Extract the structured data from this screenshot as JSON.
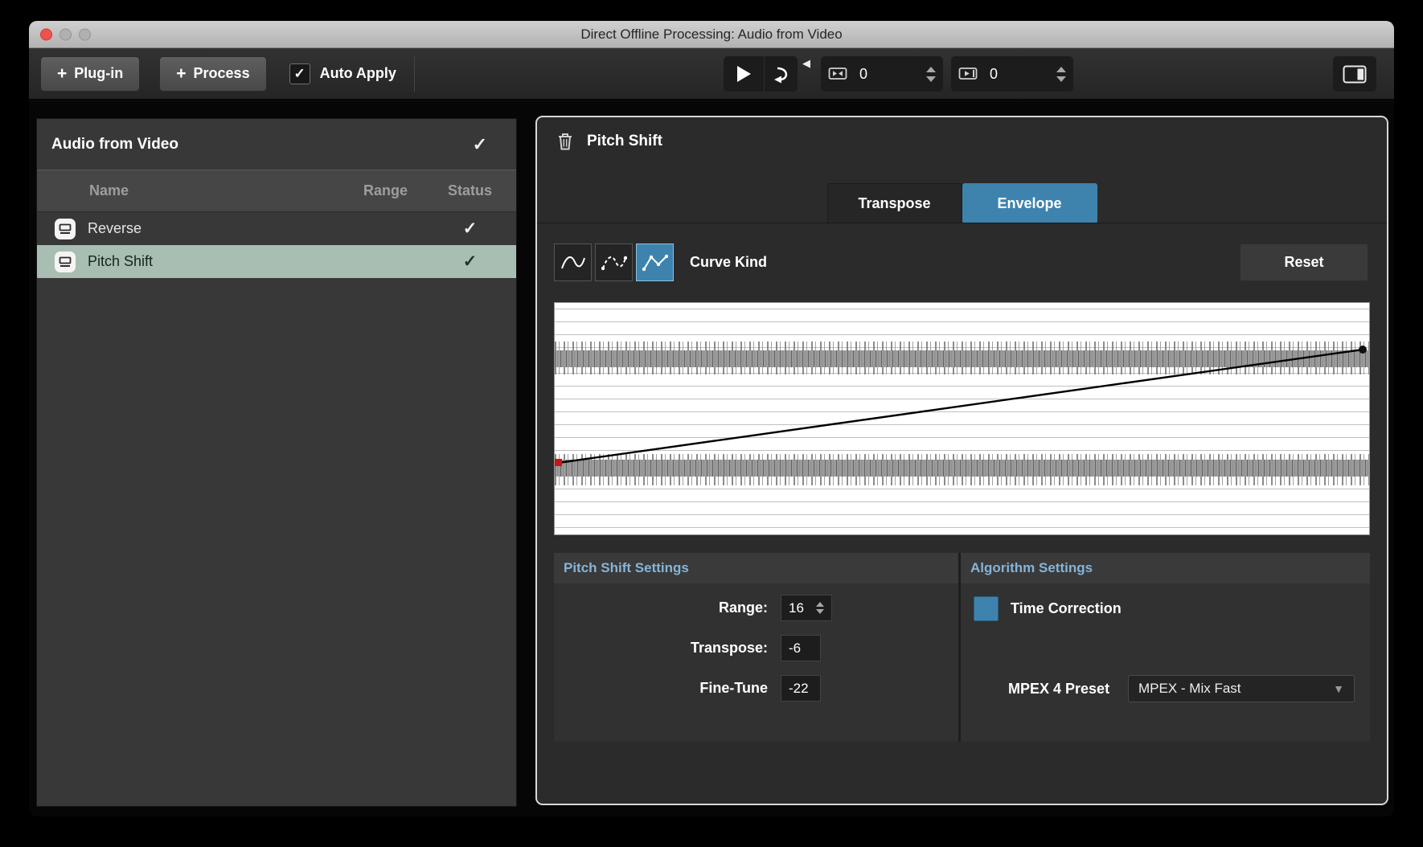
{
  "window": {
    "title": "Direct Offline Processing: Audio from Video"
  },
  "icons": {
    "plus": "+",
    "check": "✓",
    "volume_triangle": "◀",
    "dropdown_arrow": "▼"
  },
  "toolbar": {
    "plugin_label": "Plug-in",
    "process_label": "Process",
    "auto_apply_label": "Auto Apply",
    "extend_start_value": "0",
    "extend_end_value": "0"
  },
  "left_panel": {
    "title": "Audio from Video",
    "columns": {
      "name": "Name",
      "range": "Range",
      "status": "Status"
    },
    "rows": [
      {
        "name": "Reverse",
        "range": ""
      },
      {
        "name": "Pitch Shift",
        "range": ""
      }
    ]
  },
  "process_panel": {
    "title": "Pitch Shift",
    "tabs": {
      "transpose": "Transpose",
      "envelope": "Envelope"
    },
    "curve_kind_label": "Curve Kind",
    "reset_label": "Reset",
    "pitch_settings": {
      "header": "Pitch Shift Settings",
      "range_label": "Range:",
      "range_value": "16",
      "transpose_label": "Transpose:",
      "transpose_value": "-6",
      "finetune_label": "Fine-Tune",
      "finetune_value": "-22"
    },
    "algorithm_settings": {
      "header": "Algorithm Settings",
      "time_correction_label": "Time Correction",
      "mpex_label": "MPEX 4 Preset",
      "mpex_value": "MPEX - Mix Fast"
    }
  },
  "colors": {
    "accent_blue": "#3e83ad",
    "selected_row": "#a9beb2"
  }
}
